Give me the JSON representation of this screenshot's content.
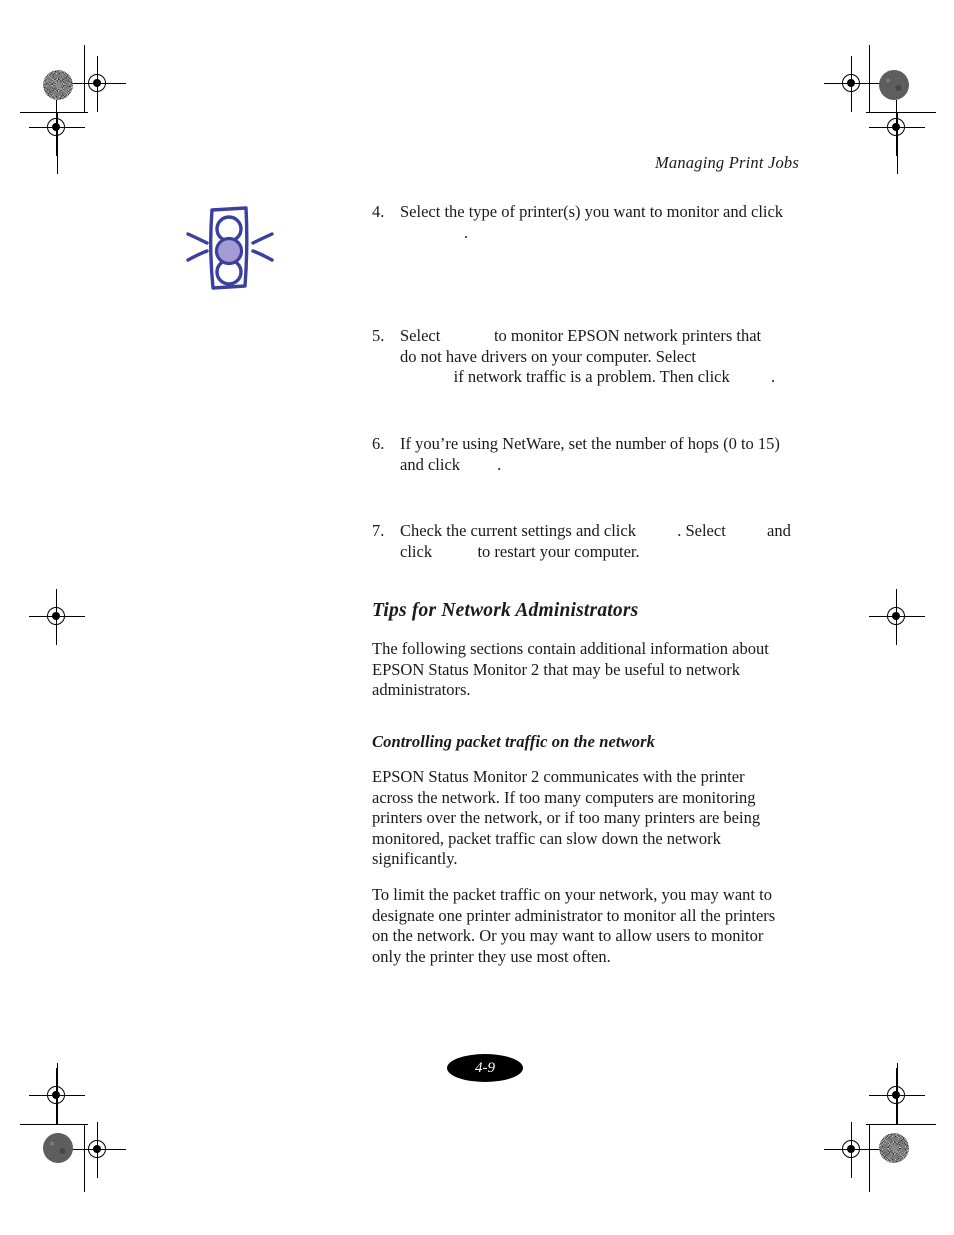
{
  "document": {
    "running_head": "Managing Print Jobs",
    "page_number": "4-9"
  },
  "icon": {
    "name": "traffic-light-tip-icon",
    "outline_color": "#3b3f9e",
    "lamp_fill_color": "#a49ad4"
  },
  "steps": [
    {
      "number": "4.",
      "lines": [
        "Select the type of printer(s) you want to monitor and click",
        "."
      ]
    },
    {
      "number": "5.",
      "lines": [
        "Select             to monitor EPSON network printers that",
        "do not have drivers on your computer. Select",
        "             if network traffic is a problem. Then click          ."
      ]
    },
    {
      "number": "6.",
      "lines": [
        "If you’re using NetWare, set the number of hops (0 to 15)",
        "and click         ."
      ]
    },
    {
      "number": "7.",
      "lines": [
        "Check the current settings and click          . Select          and",
        "click           to restart your computer."
      ]
    }
  ],
  "sections": {
    "tips": {
      "title": "Tips for Network Administrators",
      "body": "The following sections contain additional information about EPSON Status Monitor 2 that may be useful to network administrators."
    },
    "packet_traffic": {
      "title": "Controlling packet traffic on the network",
      "paragraph_1": "EPSON Status Monitor 2 communicates with the printer across the network. If too many computers are monitoring printers over the network, or if too many printers are being monitored, packet traffic can slow down the network significantly.",
      "paragraph_2": "To limit the packet traffic on your network, you may want to designate one printer administrator to monitor all the printers on the network. Or you may want to allow users to monitor only the printer they use most often."
    }
  }
}
